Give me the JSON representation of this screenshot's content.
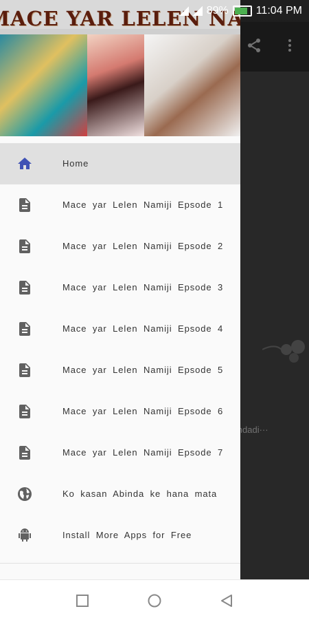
{
  "status_bar": {
    "battery": "89%",
    "time": "11:04 PM"
  },
  "drawer": {
    "header_title": "MACE YAR LELEN NAMIJI",
    "menu": [
      {
        "label": "Home",
        "icon": "home-icon",
        "active": true
      },
      {
        "label": "Mace yar Lelen Namiji Epsode 1",
        "icon": "document-icon"
      },
      {
        "label": "Mace yar Lelen Namiji Epsode 2",
        "icon": "document-icon"
      },
      {
        "label": "Mace yar Lelen Namiji Epsode 3",
        "icon": "document-icon"
      },
      {
        "label": "Mace yar Lelen Namiji Epsode 4",
        "icon": "document-icon"
      },
      {
        "label": "Mace yar Lelen Namiji Epsode 5",
        "icon": "document-icon"
      },
      {
        "label": "Mace yar Lelen Namiji Epsode 6",
        "icon": "document-icon"
      },
      {
        "label": "Mace yar Lelen Namiji Epsode 7",
        "icon": "document-icon"
      },
      {
        "label": "Ko kasan Abinda ke hana mata",
        "icon": "globe-icon"
      },
      {
        "label": "Install More Apps for Free",
        "icon": "android-icon"
      }
    ]
  },
  "background_app": {
    "snippet_text": "jindadi···",
    "actions": [
      "share-icon",
      "more-vert-icon"
    ]
  },
  "colors": {
    "accent": "#3f51b5",
    "icon_grey": "#616161",
    "header_title": "#5a1d0d"
  },
  "nav_bar": {
    "buttons": [
      "recents-button",
      "home-button",
      "back-button"
    ]
  }
}
